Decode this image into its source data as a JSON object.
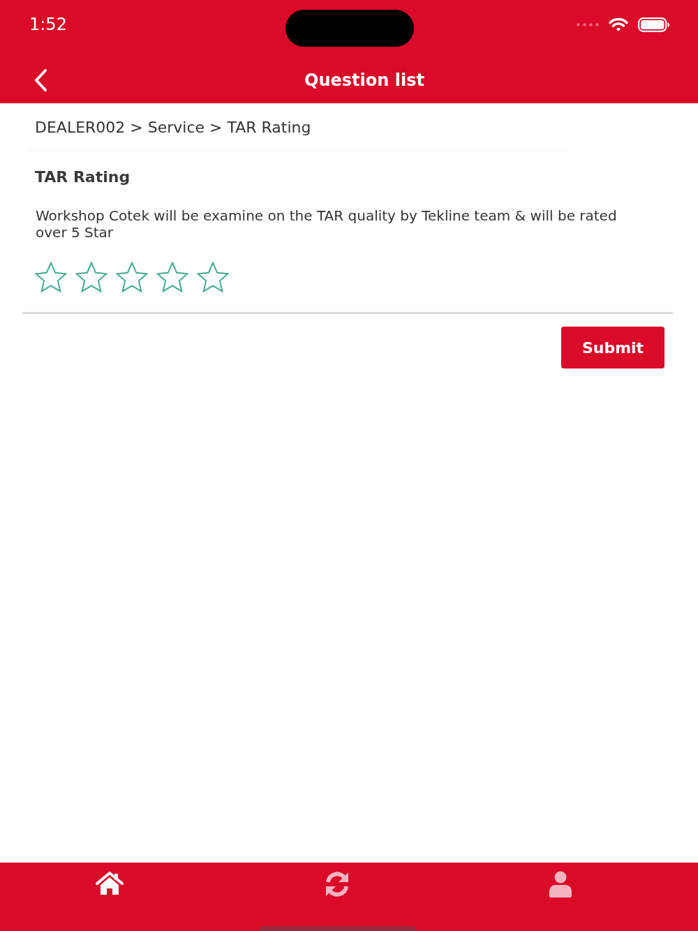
{
  "status_bar": {
    "time": "1:52"
  },
  "header": {
    "title": "Question list"
  },
  "breadcrumb": "DEALER002 > Service > TAR Rating",
  "question": {
    "title": "TAR Rating",
    "description": "Workshop Cotek will be examine on the TAR quality by Tekline team & will be rated over 5 Star",
    "stars": 0
  },
  "submit_button": "Submit",
  "nav_tabs": [
    {
      "kind": "home",
      "selected": true
    },
    {
      "kind": "refresh",
      "selected": false
    },
    {
      "kind": "profile",
      "selected": false
    }
  ]
}
